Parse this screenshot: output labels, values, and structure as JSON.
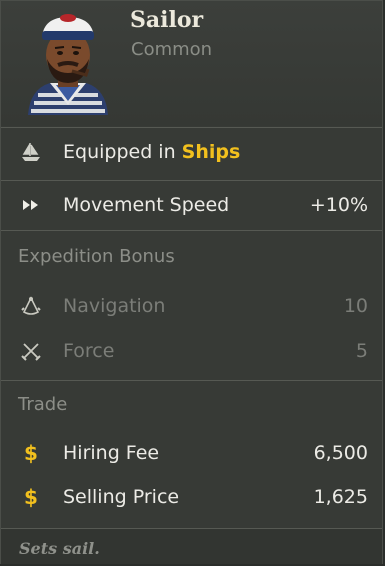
{
  "item": {
    "name": "Sailor",
    "rarity": "Common"
  },
  "equipped": {
    "prefix": "Equipped in",
    "target": "Ships"
  },
  "movement": {
    "label": "Movement Speed",
    "value": "+10%"
  },
  "expedition": {
    "heading": "Expedition Bonus",
    "stats": [
      {
        "icon": "sextant-icon",
        "label": "Navigation",
        "value": "10"
      },
      {
        "icon": "crossed-swords-icon",
        "label": "Force",
        "value": "5"
      }
    ]
  },
  "trade": {
    "heading": "Trade",
    "rows": [
      {
        "icon": "dollar-icon",
        "label": "Hiring Fee",
        "value": "6,500"
      },
      {
        "icon": "dollar-icon",
        "label": "Selling Price",
        "value": "1,625"
      }
    ]
  },
  "flavor": "Sets sail.",
  "colors": {
    "accent": "#f2c01e",
    "panel": "#373a36",
    "text": "#ecebe6",
    "muted": "#7b7d78"
  }
}
